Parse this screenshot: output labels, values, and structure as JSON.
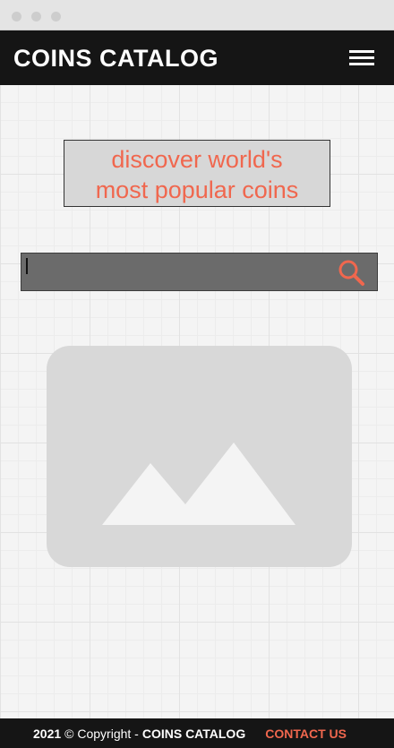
{
  "header": {
    "brand": "COINS CATALOG"
  },
  "hero": {
    "tagline_line1": "discover world's",
    "tagline_line2": "most popular coins"
  },
  "search": {
    "value": "",
    "placeholder": ""
  },
  "footer": {
    "year": "2021",
    "copyright": "© Copyright -",
    "brand": "COINS CATALOG",
    "contact_label": "CONTACT US"
  },
  "colors": {
    "accent": "#f0674e",
    "header_bg": "#151515",
    "search_bg": "#6b6b6b",
    "placeholder_bg": "#d8d8d8"
  },
  "icons": {
    "menu": "hamburger-icon",
    "search": "search-icon",
    "image": "image-placeholder-icon"
  }
}
